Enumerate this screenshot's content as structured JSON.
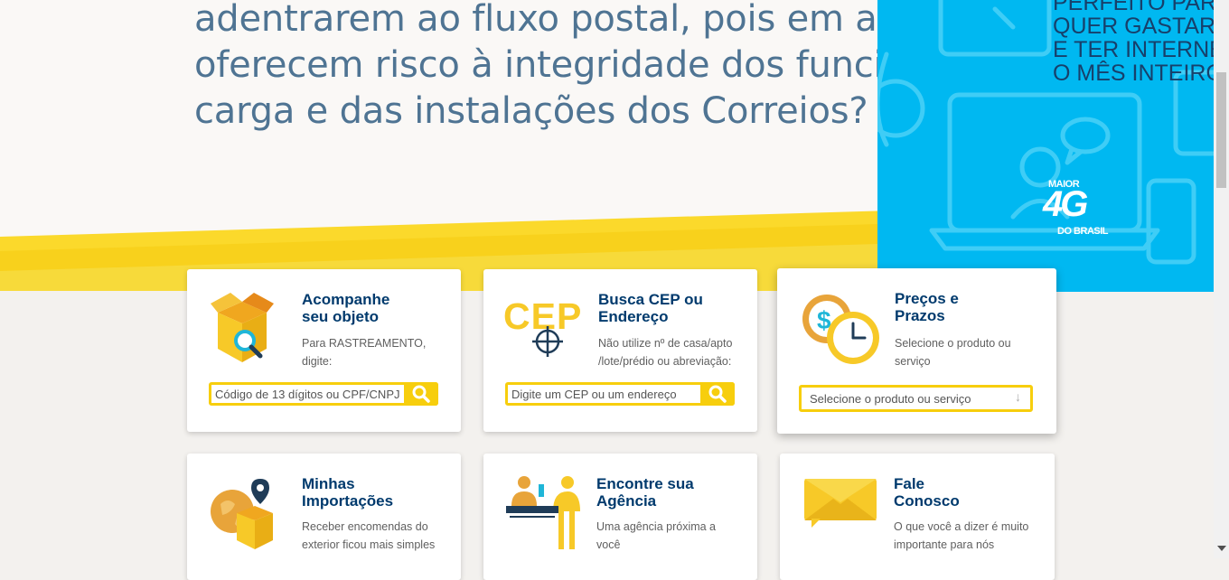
{
  "hero": {
    "lines": [
      "adentrarem ao fluxo postal, pois em alguns casos",
      "oferecem risco à integridade dos funcionários, da",
      "carga e das instalações dos Correios?"
    ]
  },
  "ad": {
    "lines": [
      "PERFEITO PARA",
      "QUER GASTAR P",
      "E TER INTERNET",
      "O MÊS INTEIRO"
    ],
    "logo_top": "MAIOR",
    "logo_big": "4G",
    "logo_bottom": "DO BRASIL"
  },
  "cards": {
    "tracking": {
      "title_1": "Acompanhe",
      "title_2": "seu objeto",
      "desc_1": "Para RASTREAMENTO,",
      "desc_2": "digite:",
      "placeholder": "Código de 13 dígitos ou CPF/CNPJ",
      "icon": "box-search-icon"
    },
    "cep": {
      "icon_text": "CEP",
      "title_1": "Busca CEP ou",
      "title_2": "Endereço",
      "desc_1": "Não utilize nº de casa/apto",
      "desc_2": "/lote/prédio ou abreviação:",
      "placeholder": "Digite um CEP ou um endereço",
      "icon": "cep-target-icon"
    },
    "prices": {
      "title_1": "Preços e",
      "title_2": "Prazos",
      "desc_1": "Selecione o produto ou",
      "desc_2": "serviço",
      "select_value": "Selecione o produto ou serviço",
      "icon": "coin-clock-icon"
    },
    "imports": {
      "title_1": "Minhas",
      "title_2": "Importações",
      "desc_1": "Receber encomendas do",
      "desc_2": "exterior ficou mais simples",
      "icon": "globe-box-pin-icon"
    },
    "agency": {
      "title_1": "Encontre sua",
      "title_2": "Agência",
      "desc_1": "Uma agência próxima a",
      "desc_2": "você",
      "icon": "agency-counter-icon"
    },
    "contact": {
      "title_1": "Fale",
      "title_2": "Conosco",
      "desc_1": "O que você a dizer é muito",
      "desc_2": "importante para nós",
      "icon": "envelope-chat-icon"
    }
  },
  "colors": {
    "accent_yellow": "#f7ce0d",
    "title_blue": "#003a6d",
    "hero_text": "#4f7493",
    "ad_blue": "#00b8f1"
  }
}
